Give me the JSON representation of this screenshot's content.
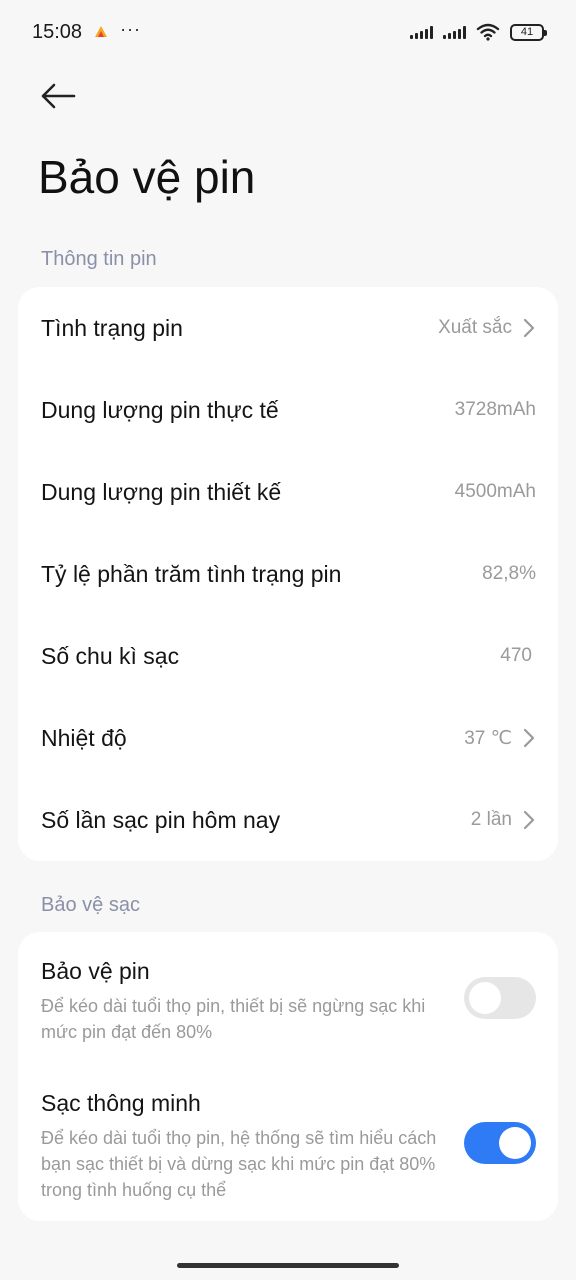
{
  "status_bar": {
    "time": "15:08",
    "more": "···",
    "battery_level": "41"
  },
  "header": {
    "title": "Bảo vệ pin"
  },
  "battery_info": {
    "section_label": "Thông tin pin",
    "rows": [
      {
        "label": "Tình trạng pin",
        "value": "Xuất sắc",
        "chevron": true
      },
      {
        "label": "Dung lượng pin thực tế",
        "value": "3728mAh",
        "chevron": false
      },
      {
        "label": "Dung lượng pin thiết kế",
        "value": "4500mAh",
        "chevron": false
      },
      {
        "label": "Tỷ lệ phần trăm tình trạng pin",
        "value": "82,8%",
        "chevron": false
      },
      {
        "label": "Số chu kì sạc",
        "value": "470",
        "chevron": false
      },
      {
        "label": "Nhiệt độ",
        "value": "37 ℃",
        "chevron": true
      },
      {
        "label": "Số lần sạc pin hôm nay",
        "value": "2 lần",
        "chevron": true
      }
    ]
  },
  "charge_protection": {
    "section_label": "Bảo vệ sạc",
    "items": [
      {
        "title": "Bảo vệ pin",
        "description": "Để kéo dài tuổi thọ pin, thiết bị sẽ ngừng sạc khi mức pin đạt đến 80%",
        "enabled": false
      },
      {
        "title": "Sạc thông minh",
        "description": "Để kéo dài tuổi thọ pin, hệ thống sẽ tìm hiểu cách bạn sạc thiết bị và dừng sạc khi mức pin đạt 80% trong tình huống cụ thể",
        "enabled": true
      }
    ]
  },
  "colors": {
    "accent": "#2f7bf5",
    "section_label": "#8a90a8",
    "background": "#f7f7f7"
  }
}
